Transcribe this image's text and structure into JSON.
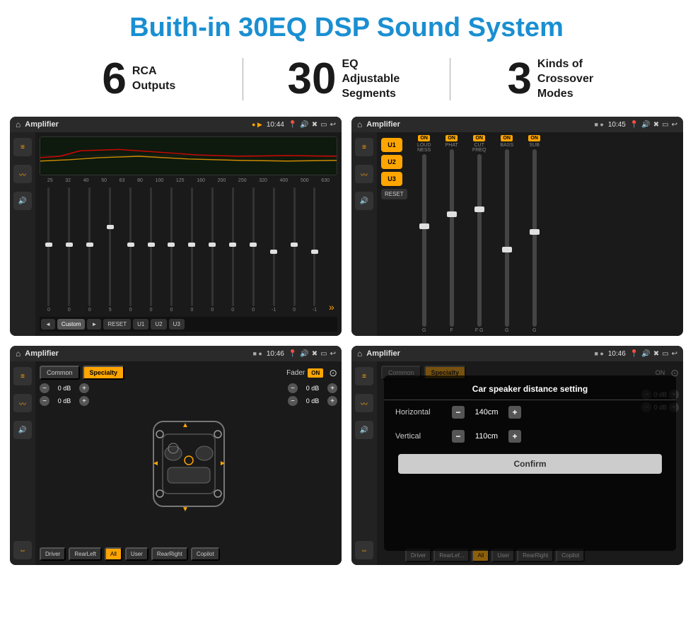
{
  "page": {
    "title": "Buith-in 30EQ DSP Sound System",
    "stats": [
      {
        "number": "6",
        "text": "RCA\nOutputs"
      },
      {
        "number": "30",
        "text": "EQ Adjustable\nSegments"
      },
      {
        "number": "3",
        "text": "Kinds of\nCrossover Modes"
      }
    ]
  },
  "screen1": {
    "topbar": {
      "icon": "🏠",
      "title": "Amplifier",
      "time": "10:44",
      "status_icons": [
        "📍",
        "🔊",
        "✖",
        "🔲",
        "↩"
      ]
    },
    "eq_freqs": [
      "25",
      "32",
      "40",
      "50",
      "63",
      "80",
      "100",
      "125",
      "160",
      "200",
      "250",
      "320",
      "400",
      "500",
      "630"
    ],
    "eq_values": [
      "0",
      "0",
      "0",
      "5",
      "0",
      "0",
      "0",
      "0",
      "0",
      "0",
      "0",
      "-1",
      "0",
      "-1"
    ],
    "bottom_btns": [
      "◄",
      "Custom",
      "►",
      "RESET",
      "U1",
      "U2",
      "U3"
    ]
  },
  "screen2": {
    "topbar": {
      "icon": "🏠",
      "title": "Amplifier",
      "time": "10:45"
    },
    "presets": [
      "U1",
      "U2",
      "U3"
    ],
    "channels": [
      {
        "label": "LOUDNESS",
        "on": true
      },
      {
        "label": "PHAT",
        "on": true
      },
      {
        "label": "CUT FREQ",
        "on": true
      },
      {
        "label": "BASS",
        "on": true
      },
      {
        "label": "SUB",
        "on": true
      }
    ],
    "reset_label": "RESET"
  },
  "screen3": {
    "topbar": {
      "icon": "🏠",
      "title": "Amplifier",
      "time": "10:46"
    },
    "modes": [
      {
        "label": "Common",
        "active": false
      },
      {
        "label": "Specialty",
        "active": true
      }
    ],
    "fader_label": "Fader",
    "fader_on": "ON",
    "db_values": [
      "-0 dB",
      "-0 dB",
      "-0 dB",
      "-0 dB"
    ],
    "bottom_btns": [
      "Driver",
      "RearLeft",
      "All",
      "User",
      "RearRight",
      "Copilot"
    ]
  },
  "screen4": {
    "topbar": {
      "icon": "🏠",
      "title": "Amplifier",
      "time": "10:46"
    },
    "modes": [
      {
        "label": "Common",
        "active": false
      },
      {
        "label": "Specialty",
        "active": true
      }
    ],
    "dialog": {
      "title": "Car speaker distance setting",
      "rows": [
        {
          "label": "Horizontal",
          "value": "140cm"
        },
        {
          "label": "Vertical",
          "value": "110cm"
        }
      ],
      "confirm_label": "Confirm"
    },
    "db_values": [
      "-0 dB",
      "-0 dB"
    ],
    "bottom_btns": [
      "Driver",
      "RearLef...",
      "All",
      "User",
      "RearRight",
      "Copilot"
    ]
  }
}
